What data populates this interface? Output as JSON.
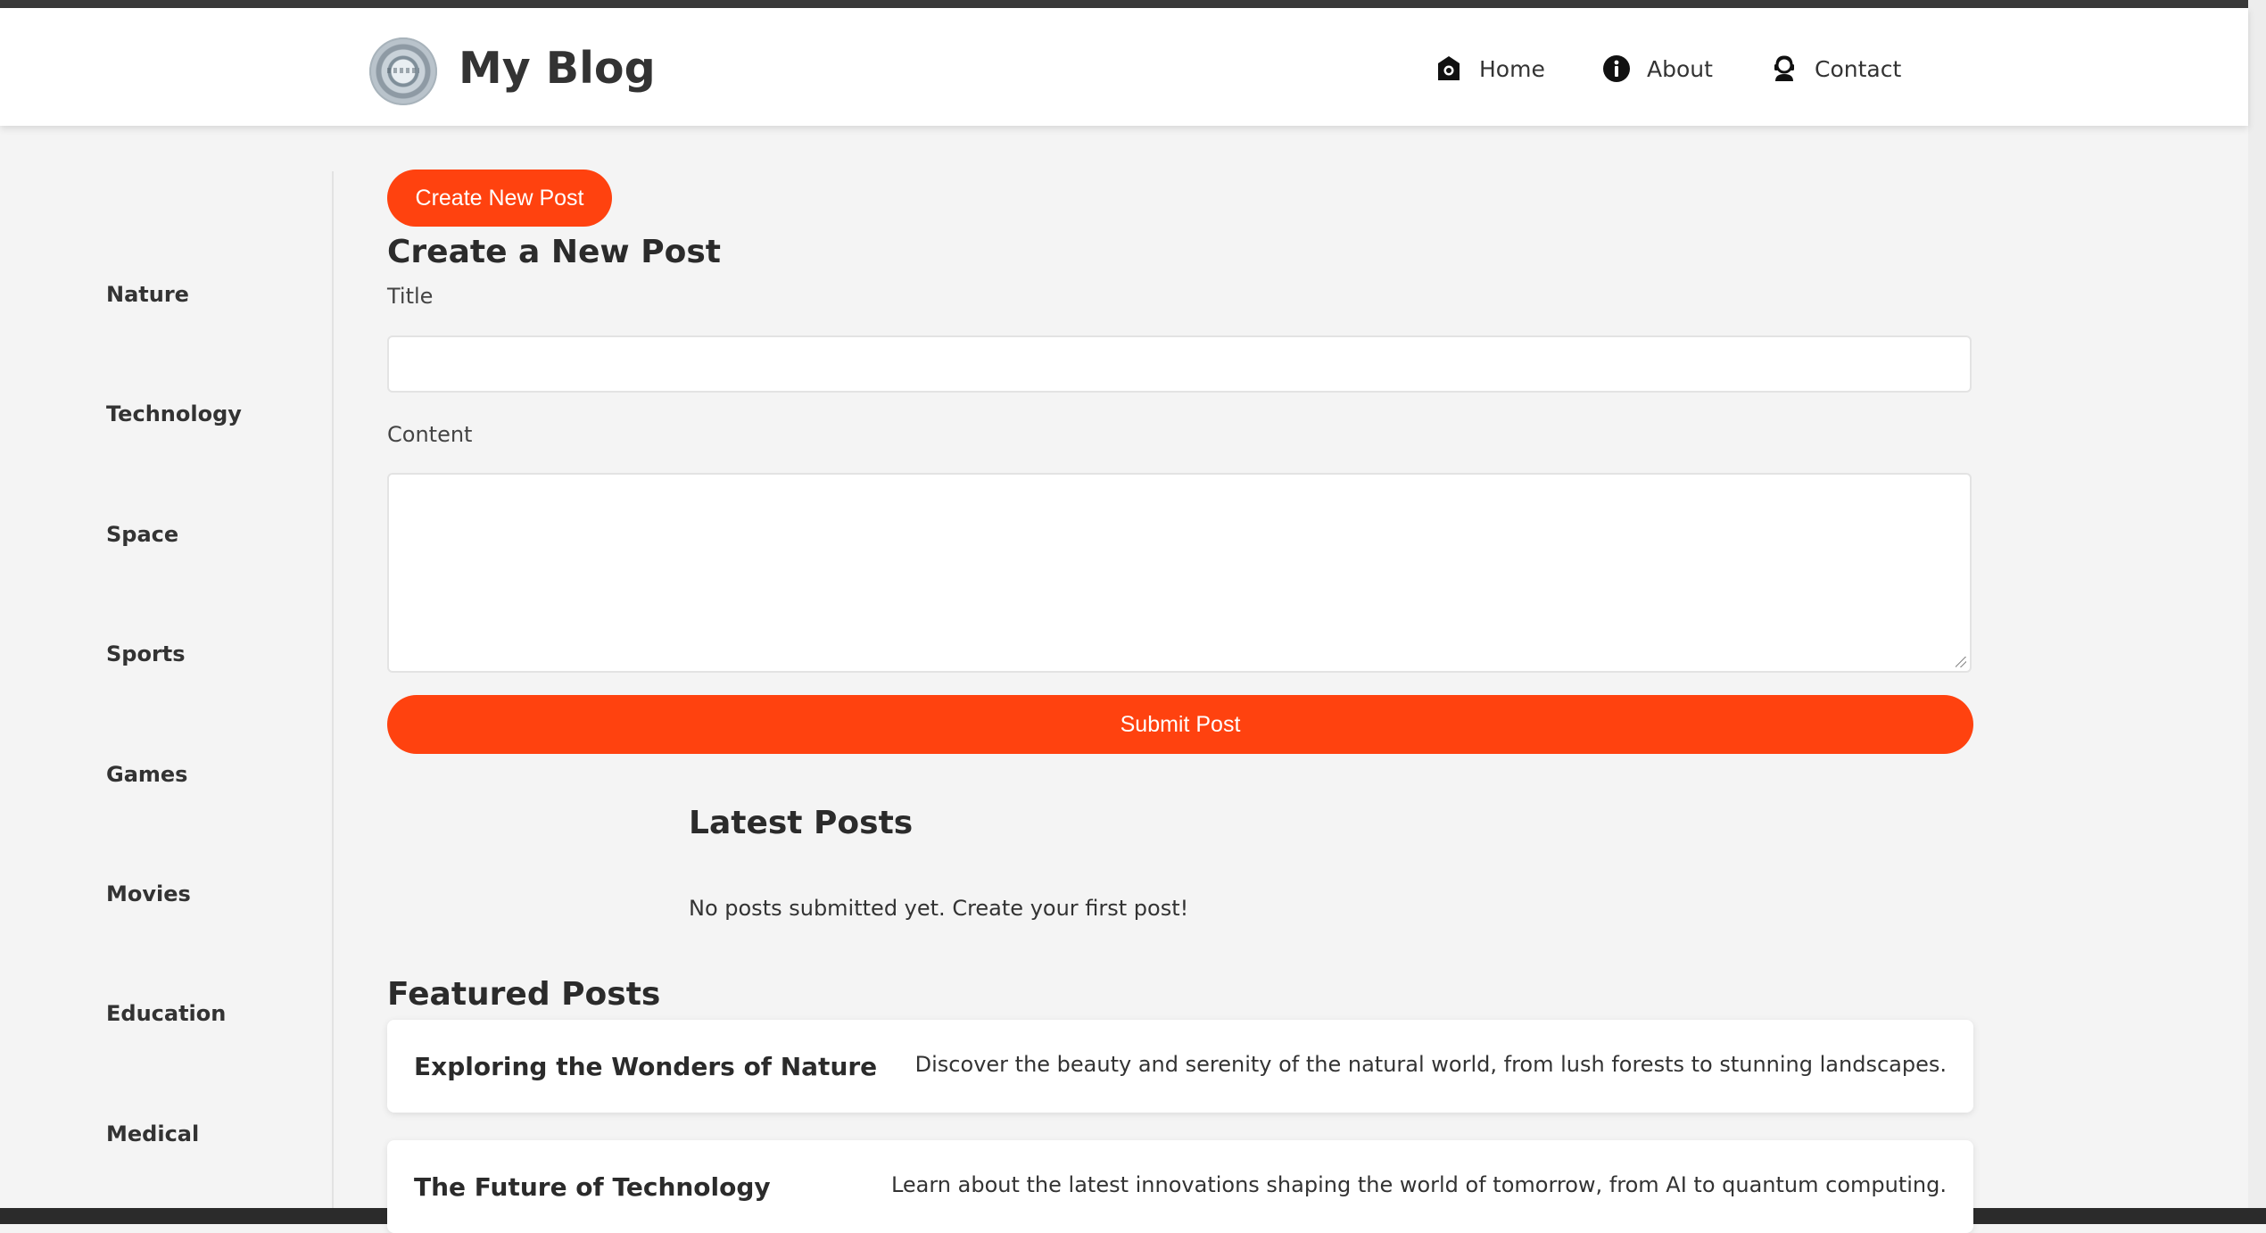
{
  "header": {
    "site_title": "My Blog",
    "logo_icon": "blog-logo-icon",
    "nav": [
      {
        "label": "Home",
        "icon": "home-icon"
      },
      {
        "label": "About",
        "icon": "info-icon"
      },
      {
        "label": "Contact",
        "icon": "contact-icon"
      }
    ]
  },
  "sidebar": {
    "categories": [
      "Nature",
      "Technology",
      "Space",
      "Sports",
      "Games",
      "Movies",
      "Education",
      "Medical"
    ]
  },
  "main": {
    "create_button_label": "Create New Post",
    "form_title": "Create a New Post",
    "title_label": "Title",
    "title_value": "",
    "content_label": "Content",
    "content_value": "",
    "submit_label": "Submit Post",
    "latest_title": "Latest Posts",
    "latest_empty_message": "No posts submitted yet. Create your first post!",
    "featured_title": "Featured Posts",
    "featured_posts": [
      {
        "title": "Exploring the Wonders of Nature",
        "description": "Discover the beauty and serenity of the natural world, from lush forests to stunning landscapes."
      },
      {
        "title": "The Future of Technology",
        "description": "Learn about the latest innovations shaping the world of tomorrow, from AI to quantum computing."
      }
    ]
  },
  "colors": {
    "accent": "#ff420f",
    "background": "#f4f4f4",
    "header_background": "#ffffff"
  }
}
